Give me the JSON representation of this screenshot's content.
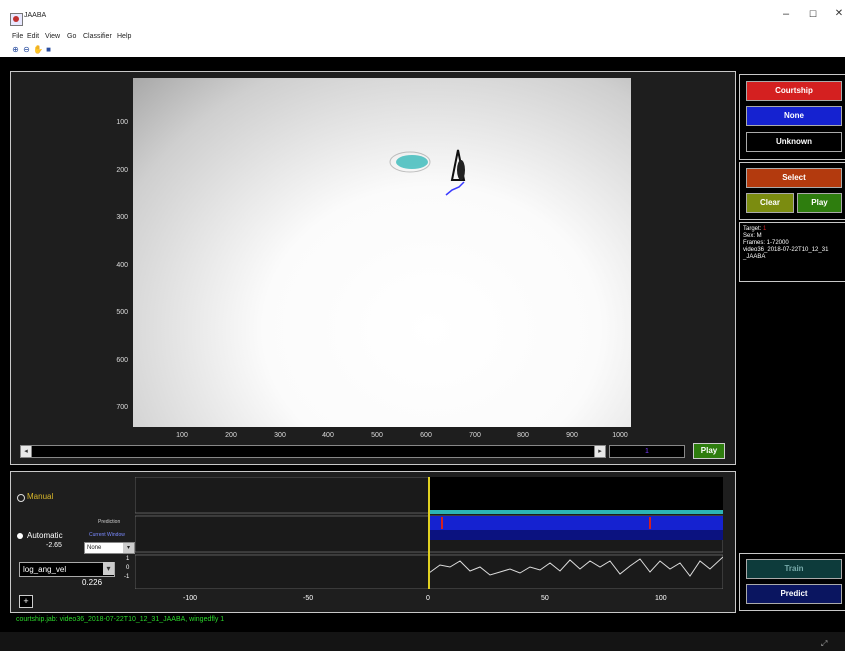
{
  "window": {
    "title": "JAABA",
    "minimize": "–",
    "maximize": "☐",
    "close": "✕"
  },
  "menu": [
    "File",
    "Edit",
    "View",
    "Go",
    "Classifier",
    "Help"
  ],
  "toolbar": [
    "zoom-in-icon",
    "zoom-out-icon",
    "pan-icon",
    "save-icon"
  ],
  "video": {
    "y_ticks": [
      "100",
      "200",
      "300",
      "400",
      "500",
      "600",
      "700"
    ],
    "x_ticks": [
      "100",
      "200",
      "300",
      "400",
      "500",
      "600",
      "700",
      "800",
      "900",
      "1000"
    ],
    "frame_value": "1",
    "play_label": "Play"
  },
  "labels": {
    "courtship": "Courtship",
    "none": "None",
    "unknown": "Unknown",
    "courtship_color": "#d42020",
    "none_color": "#1522d0",
    "unknown_color": "#000000"
  },
  "actions": {
    "select": "Select",
    "clear": "Clear",
    "play": "Play"
  },
  "info": {
    "target_label": "Target:",
    "target_value": "1",
    "sex": "Sex: M",
    "frames": "Frames: 1-72000",
    "file": "video36_2018-07-22T10_12_31",
    "file2": "_JAABA"
  },
  "timeline": {
    "manual": "Manual",
    "automatic": "Automatic",
    "score": "-2.65",
    "prediction": "Prediction",
    "current_window": "Current Window",
    "none_select": "None",
    "feature": "log_ang_vel",
    "feature_value": "0.226",
    "y_ticks": [
      "1",
      "0",
      "-1"
    ],
    "x_ticks": [
      "-100",
      "-50",
      "0",
      "50",
      "100"
    ],
    "add_button": "+"
  },
  "classifier": {
    "train": "Train",
    "predict": "Predict"
  },
  "status": "courtship.jab: video36_2018-07-22T10_12_31_JAABA, wingedfly 1"
}
